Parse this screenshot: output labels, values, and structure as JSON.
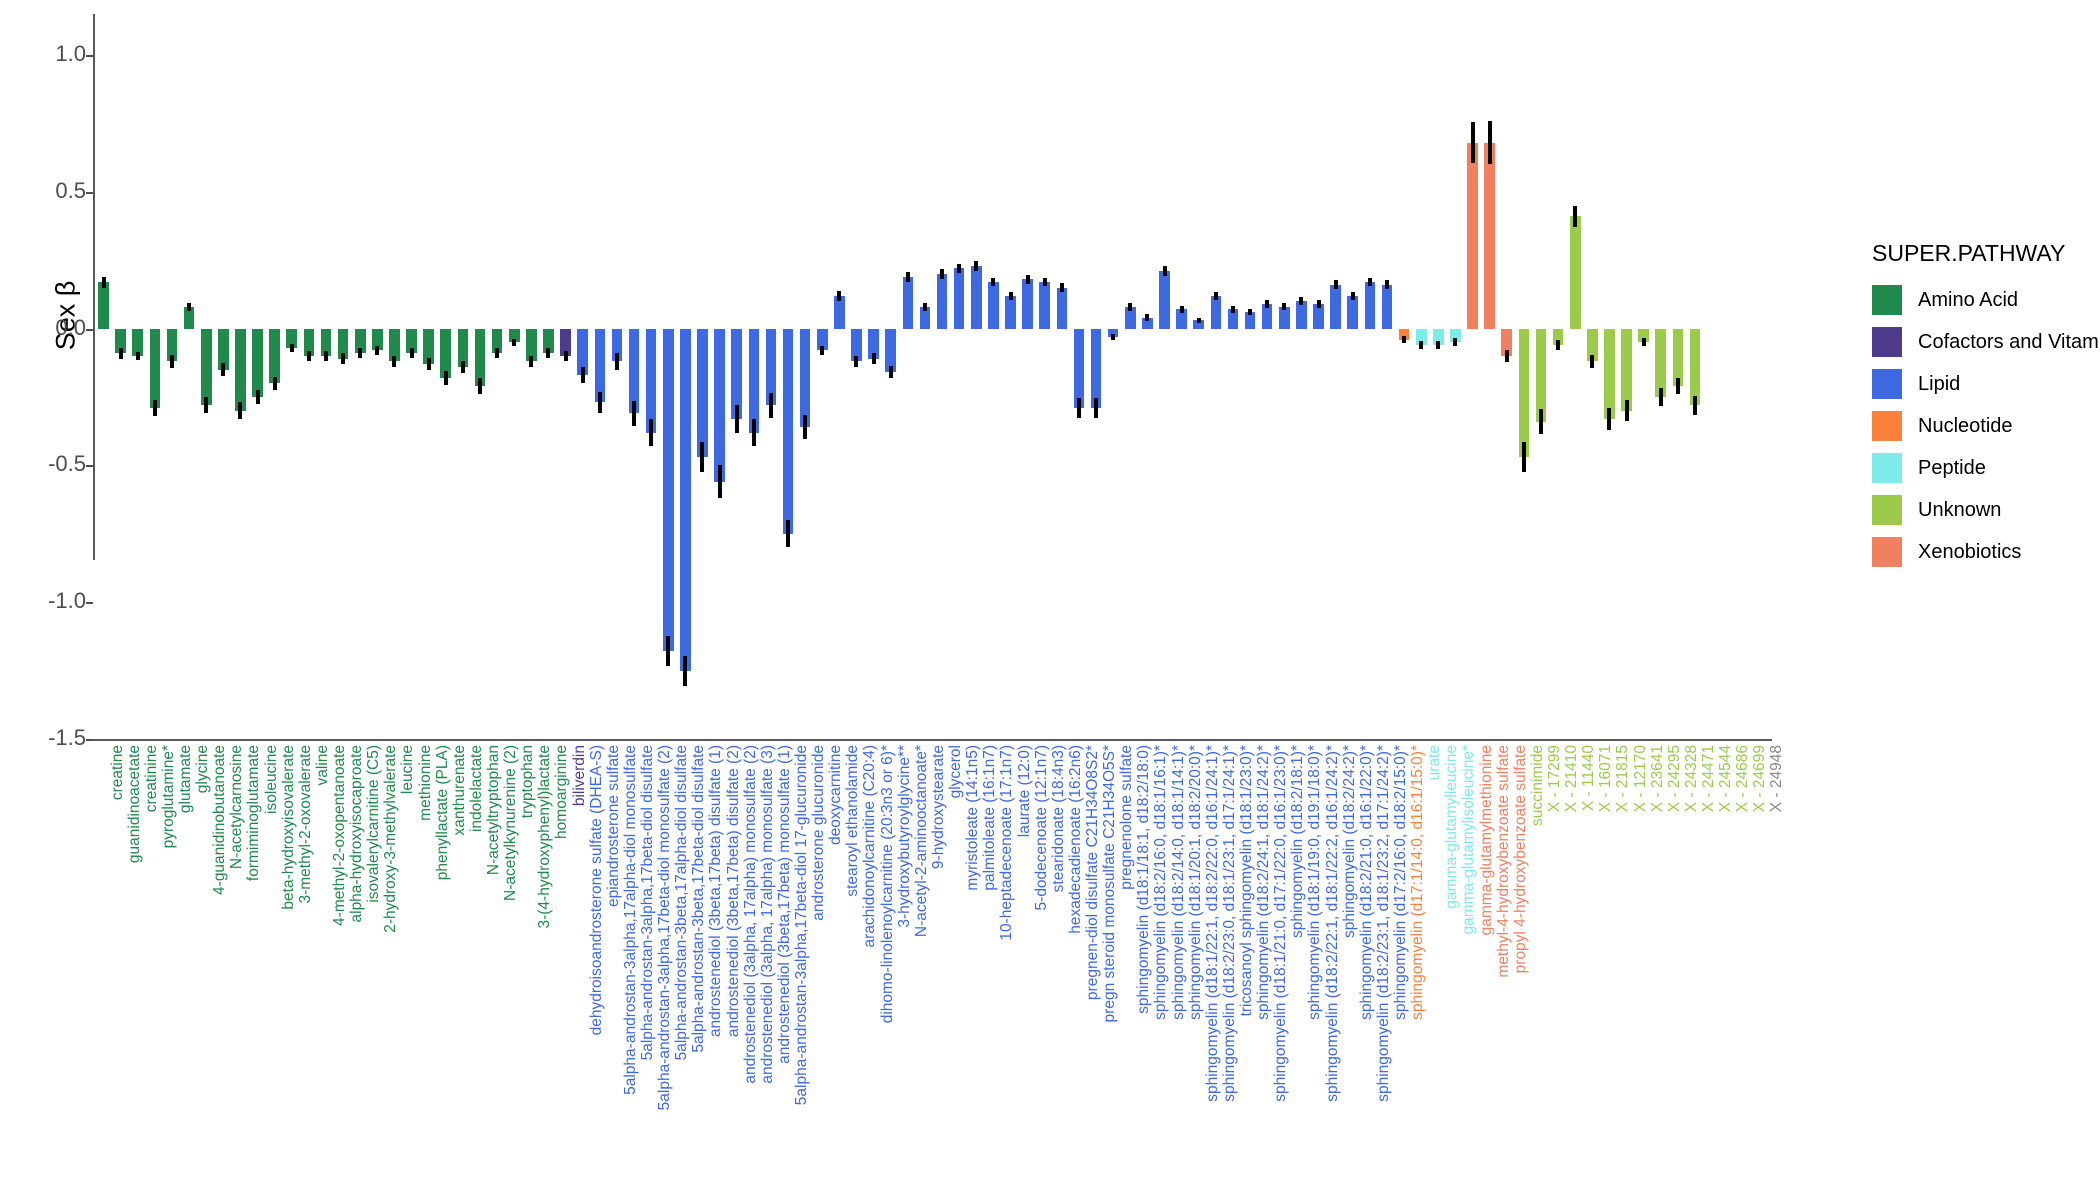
{
  "chart_data": {
    "type": "bar",
    "title": "",
    "xlabel": "",
    "ylabel": "Sex β",
    "ylim": [
      -1.5,
      1.15
    ],
    "yticks": [
      1.0,
      0.5,
      0.0,
      -0.5,
      -1.0,
      -1.5
    ],
    "ytick_labels": [
      "1.0",
      "0.5",
      "0.0",
      "-0.5",
      "-1.0",
      "-1.5"
    ],
    "grid": false,
    "legend_position": "right",
    "error_bars": "standard error",
    "legend": {
      "title": "SUPER.PATHWAY",
      "entries": [
        {
          "label": "Amino Acid",
          "color": "#1f8a4c"
        },
        {
          "label": "Cofactors and Vitamins",
          "color": "#4f3b8b"
        },
        {
          "label": "Lipid",
          "color": "#3e69e0"
        },
        {
          "label": "Nucleotide",
          "color": "#f9813a"
        },
        {
          "label": "Peptide",
          "color": "#7eeaea"
        },
        {
          "label": "Unknown",
          "color": "#9ccb4b"
        },
        {
          "label": "Xenobiotics",
          "color": "#f08060"
        }
      ]
    },
    "categories": [
      "creatine",
      "guanidinoacetate",
      "creatinine",
      "pyroglutamine*",
      "glutamate",
      "glycine",
      "4-guanidinobutanoate",
      "N-acetylcarnosine",
      "formiminoglutamate",
      "isoleucine",
      "beta-hydroxyisovalerate",
      "3-methyl-2-oxovalerate",
      "valine",
      "4-methyl-2-oxopentanoate",
      "alpha-hydroxyisocaproate",
      "isovalerylcarnitine (C5)",
      "2-hydroxy-3-methylvalerate",
      "leucine",
      "methionine",
      "phenyllactate (PLA)",
      "xanthurenate",
      "indolelactate",
      "N-acetyltryptophan",
      "N-acetylkynurenine (2)",
      "tryptophan",
      "3-(4-hydroxyphenyl)lactate",
      "homoarginine",
      "biliverdin",
      "dehydroisoandrosterone sulfate (DHEA-S)",
      "epiandrosterone sulfate",
      "5alpha-androstan-3alpha,17alpha-diol monosulfate",
      "5alpha-androstan-3alpha,17beta-diol disulfate",
      "5alpha-androstan-3alpha,17beta-diol monosulfate (2)",
      "5alpha-androstan-3beta,17alpha-diol disulfate",
      "5alpha-androstan-3beta,17beta-diol disulfate",
      "androstenediol (3beta,17beta) disulfate (1)",
      "androstenediol (3beta,17beta) disulfate (2)",
      "androstenediol (3alpha, 17alpha) monosulfate (2)",
      "androstenediol (3alpha, 17alpha) monosulfate (3)",
      "androstenediol (3beta,17beta) monosulfate (1)",
      "5alpha-androstan-3alpha,17beta-diol 17-glucuronide",
      "androsterone glucuronide",
      "deoxycarnitine",
      "stearoyl ethanolamide",
      "arachidonoylcarnitine (C20:4)",
      "dihomo-linolenoylcarnitine (20:3n3 or 6)*",
      "3-hydroxybutyroylglycine**",
      "N-acetyl-2-aminooctanoate*",
      "9-hydroxystearate",
      "glycerol",
      "myristoleate (14:1n5)",
      "palmitoleate (16:1n7)",
      "10-heptadecenoate (17:1n7)",
      "laurate (12:0)",
      "5-dodecenoate (12:1n7)",
      "stearidonate (18:4n3)",
      "hexadecadienoate (16:2n6)",
      "pregnen-diol disulfate C21H34O8S2*",
      "pregn steroid monosulfate C21H34O5S*",
      "pregnenolone sulfate",
      "sphingomyelin (d18:1/18:1, d18:2/18:0)",
      "sphingomyelin (d18:2/16:0, d18:1/16:1)*",
      "sphingomyelin (d18:2/14:0, d18:1/14:1)*",
      "sphingomyelin (d18:1/20:1, d18:2/20:0)*",
      "sphingomyelin (d18:1/22:1, d18:2/22:0, d16:1/24:1)*",
      "sphingomyelin (d18:2/23:0, d18:1/23:1, d17:1/24:1)*",
      "tricosanoyl sphingomyelin (d18:1/23:0)*",
      "sphingomyelin (d18:2/24:1, d18:1/24:2)*",
      "sphingomyelin (d18:1/21:0, d17:1/22:0, d16:1/23:0)*",
      "sphingomyelin (d18:2/18:1)*",
      "sphingomyelin (d18:1/19:0, d19:1/18:0)*",
      "sphingomyelin (d18:2/22:1, d18:1/22:2, d16:1/24:2)*",
      "sphingomyelin (d18:2/24:2)*",
      "sphingomyelin (d18:2/21:0, d16:1/22:0)*",
      "sphingomyelin (d18:2/23:1, d18:1/23:2, d17:1/24:2)*",
      "sphingomyelin (d17:2/16:0, d18:2/15:0)*",
      "sphingomyelin (d17:1/14:0, d16:1/15:0)*",
      "urate",
      "gamma-glutamylleucine",
      "gamma-glutamylisoleucine*",
      "gamma-glutamylmethionine",
      "methyl-4-hydroxybenzoate sulfate",
      "propyl 4-hydroxybenzoate sulfate",
      "succinimide",
      "X - 17299",
      "X - 21410",
      "X - 11440",
      "X - 16071",
      "X - 21815",
      "X - 12170",
      "X - 23641",
      "X - 24295",
      "X - 24328",
      "X - 24471",
      "X - 24544",
      "X - 24686",
      "X - 24699",
      "X - 24948"
    ],
    "groups": [
      "Amino Acid",
      "Amino Acid",
      "Amino Acid",
      "Amino Acid",
      "Amino Acid",
      "Amino Acid",
      "Amino Acid",
      "Amino Acid",
      "Amino Acid",
      "Amino Acid",
      "Amino Acid",
      "Amino Acid",
      "Amino Acid",
      "Amino Acid",
      "Amino Acid",
      "Amino Acid",
      "Amino Acid",
      "Amino Acid",
      "Amino Acid",
      "Amino Acid",
      "Amino Acid",
      "Amino Acid",
      "Amino Acid",
      "Amino Acid",
      "Amino Acid",
      "Amino Acid",
      "Amino Acid",
      "Cofactors and Vitamins",
      "Lipid",
      "Lipid",
      "Lipid",
      "Lipid",
      "Lipid",
      "Lipid",
      "Lipid",
      "Lipid",
      "Lipid",
      "Lipid",
      "Lipid",
      "Lipid",
      "Lipid",
      "Lipid",
      "Lipid",
      "Lipid",
      "Lipid",
      "Lipid",
      "Lipid",
      "Lipid",
      "Lipid",
      "Lipid",
      "Lipid",
      "Lipid",
      "Lipid",
      "Lipid",
      "Lipid",
      "Lipid",
      "Lipid",
      "Lipid",
      "Lipid",
      "Lipid",
      "Lipid",
      "Lipid",
      "Lipid",
      "Lipid",
      "Lipid",
      "Lipid",
      "Lipid",
      "Lipid",
      "Lipid",
      "Lipid",
      "Lipid",
      "Lipid",
      "Lipid",
      "Lipid",
      "Lipid",
      "Lipid",
      "Nucleotide",
      "Peptide",
      "Peptide",
      "Peptide",
      "Xenobiotics",
      "Xenobiotics",
      "Xenobiotics",
      "Unknown",
      "Unknown",
      "Unknown",
      "Unknown",
      "Unknown",
      "Unknown",
      "Unknown",
      "Unknown",
      "Unknown",
      "Unknown",
      "Unknown",
      "Unknown",
      "Unknown",
      "Unknown"
    ],
    "values": [
      0.17,
      -0.09,
      -0.1,
      -0.29,
      -0.12,
      0.08,
      -0.28,
      -0.15,
      -0.3,
      -0.25,
      -0.2,
      -0.07,
      -0.1,
      -0.1,
      -0.11,
      -0.09,
      -0.08,
      -0.12,
      -0.09,
      -0.13,
      -0.18,
      -0.14,
      -0.21,
      -0.09,
      -0.05,
      -0.12,
      -0.09,
      -0.1,
      -0.17,
      -0.27,
      -0.12,
      -0.31,
      -0.38,
      -1.18,
      -1.25,
      -0.47,
      -0.56,
      -0.33,
      -0.38,
      -0.28,
      -0.75,
      -0.36,
      -0.08,
      0.12,
      -0.12,
      -0.11,
      -0.16,
      0.19,
      0.08,
      0.2,
      0.22,
      0.23,
      0.17,
      0.12,
      0.18,
      0.17,
      0.15,
      -0.29,
      -0.29,
      -0.03,
      0.08,
      0.04,
      0.21,
      0.07,
      0.03,
      0.12,
      0.07,
      0.06,
      0.09,
      0.08,
      0.1,
      0.09,
      0.16,
      0.12,
      0.17,
      0.16,
      -0.04,
      -0.06,
      -0.06,
      -0.05,
      0.68,
      0.68,
      -0.1,
      -0.47,
      -0.34,
      -0.06,
      0.41,
      -0.12,
      -0.33,
      -0.3,
      -0.05,
      -0.25,
      -0.21,
      -0.28
    ],
    "errors": [
      0.02,
      0.02,
      0.015,
      0.03,
      0.025,
      0.015,
      0.03,
      0.025,
      0.03,
      0.025,
      0.025,
      0.015,
      0.018,
      0.018,
      0.02,
      0.018,
      0.015,
      0.02,
      0.018,
      0.022,
      0.025,
      0.022,
      0.028,
      0.018,
      0.012,
      0.02,
      0.018,
      0.018,
      0.03,
      0.04,
      0.03,
      0.045,
      0.05,
      0.055,
      0.055,
      0.055,
      0.06,
      0.05,
      0.05,
      0.045,
      0.05,
      0.045,
      0.018,
      0.018,
      0.02,
      0.02,
      0.022,
      0.018,
      0.014,
      0.018,
      0.018,
      0.018,
      0.016,
      0.015,
      0.017,
      0.016,
      0.016,
      0.035,
      0.035,
      0.012,
      0.014,
      0.012,
      0.018,
      0.013,
      0.01,
      0.014,
      0.013,
      0.012,
      0.014,
      0.013,
      0.014,
      0.014,
      0.016,
      0.015,
      0.016,
      0.016,
      0.014,
      0.016,
      0.016,
      0.015,
      0.075,
      0.08,
      0.022,
      0.055,
      0.045,
      0.018,
      0.04,
      0.025,
      0.04,
      0.038,
      0.015,
      0.032,
      0.03,
      0.035
    ]
  }
}
